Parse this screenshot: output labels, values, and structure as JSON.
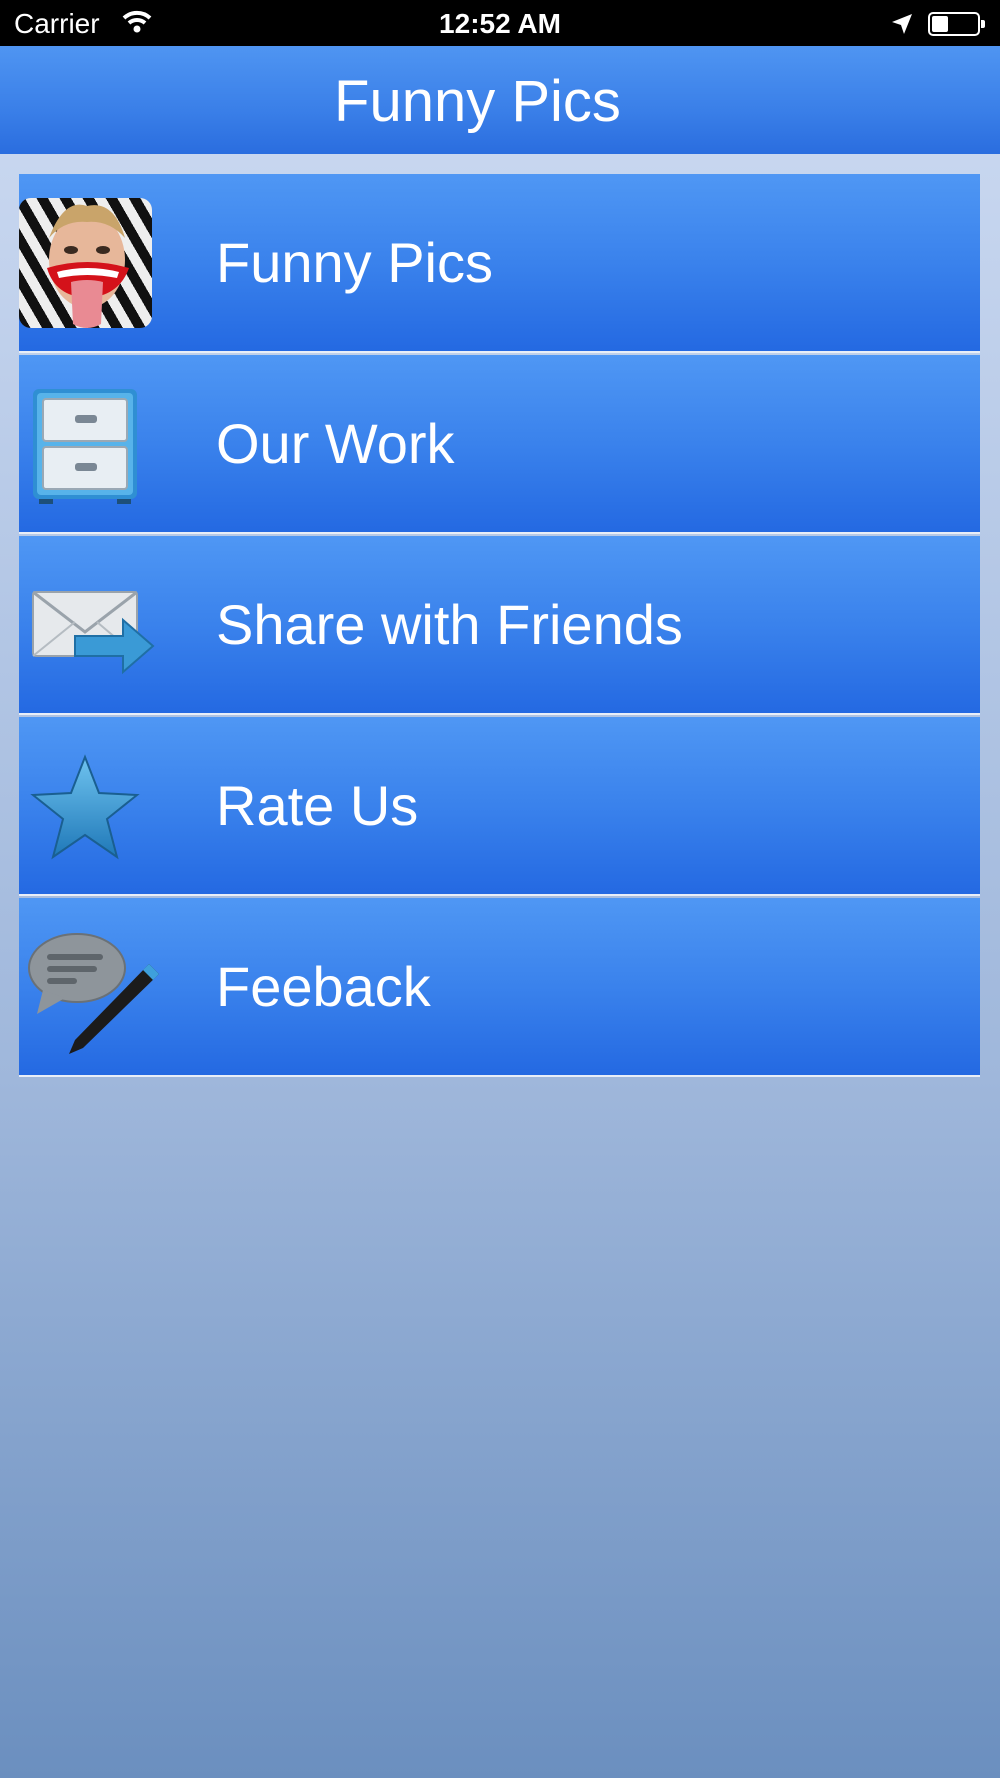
{
  "status_bar": {
    "carrier": "Carrier",
    "time": "12:52 AM",
    "wifi_icon": "wifi-icon",
    "location_icon": "location-arrow-icon",
    "battery_icon": "battery-icon"
  },
  "nav": {
    "title": "Funny Pics"
  },
  "menu": {
    "items": [
      {
        "label": "Funny Pics",
        "icon": "funny-photo-icon"
      },
      {
        "label": "Our Work",
        "icon": "file-cabinet-icon"
      },
      {
        "label": "Share with Friends",
        "icon": "mail-forward-icon"
      },
      {
        "label": "Rate Us",
        "icon": "star-icon"
      },
      {
        "label": "Feeback",
        "icon": "comment-pencil-icon"
      }
    ]
  },
  "colors": {
    "nav_top": "#4f95f2",
    "nav_bottom": "#2a6ddf",
    "row_top": "#4f97f4",
    "row_bottom": "#2469e2",
    "text": "#ffffff"
  }
}
